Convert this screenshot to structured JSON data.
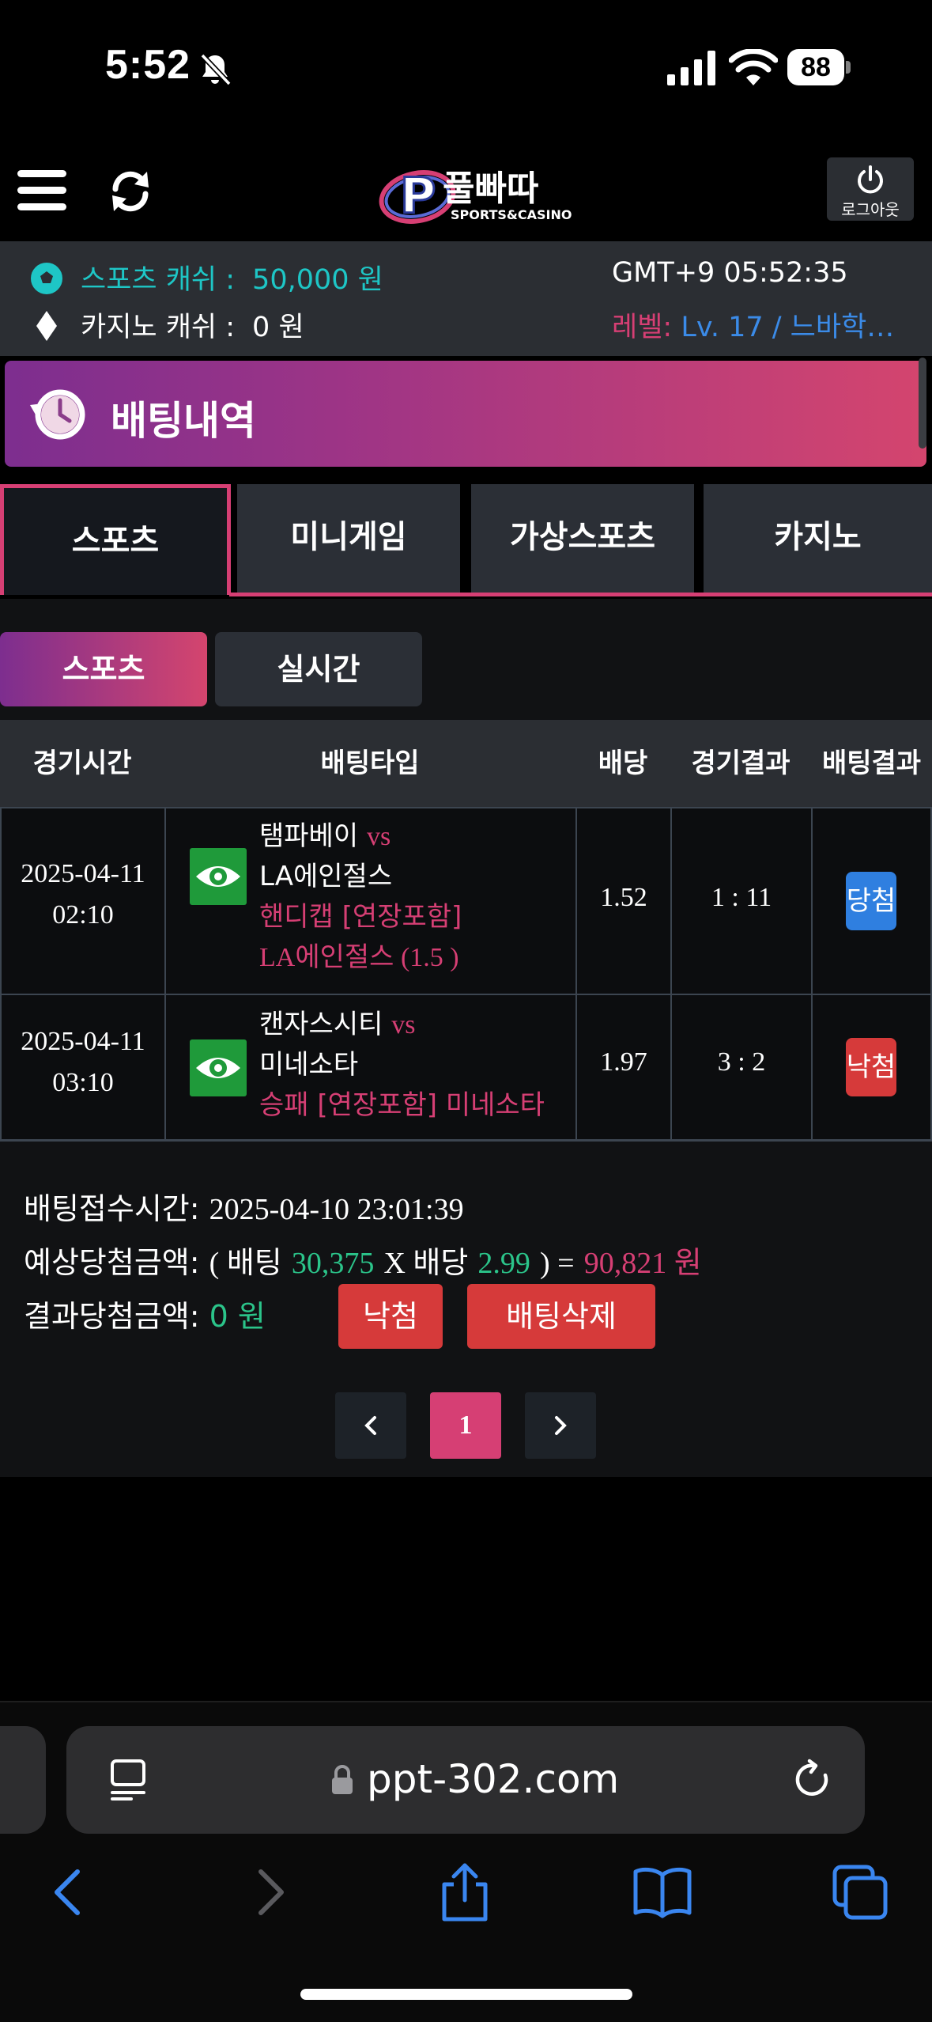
{
  "status_bar": {
    "time": "5:52",
    "battery": "88"
  },
  "header": {
    "logo_text": "풀빠따",
    "logo_sub": "SPORTS&CASINO",
    "logout_label": "로그아웃"
  },
  "info": {
    "sports_cash_label": "스포츠 캐쉬 :",
    "sports_cash_value": "50,000 원",
    "casino_cash_label": "카지노 캐쉬 :",
    "casino_cash_value": "0 원",
    "server_time": "GMT+9 05:52:35",
    "level_label": "레벨:",
    "level_value": "Lv. 17 / 느바학…"
  },
  "page_title": "배팅내역",
  "tabs": [
    "스포츠",
    "미니게임",
    "가상스포츠",
    "카지노"
  ],
  "sub_tabs": [
    "스포츠",
    "실시간"
  ],
  "table": {
    "headers": [
      "경기시간",
      "배팅타입",
      "배당",
      "경기결과",
      "배팅결과"
    ],
    "rows": [
      {
        "date": "2025-04-11",
        "time": "02:10",
        "home": "탬파베이",
        "vs": "vs",
        "away": "LA에인절스",
        "market": "핸디캡 [연장포함]",
        "pick": "LA에인절스 (1.5 )",
        "odds": "1.52",
        "score": "1 : 11",
        "result": "당첨"
      },
      {
        "date": "2025-04-11",
        "time": "03:10",
        "home": "캔자스시티",
        "vs": "vs",
        "away": "미네소타",
        "market": "승패 [연장포함] 미네소타",
        "odds": "1.97",
        "score": "3 : 2",
        "result": "낙첨"
      }
    ]
  },
  "summary": {
    "accept_label": "배팅접수시간:",
    "accept_time": "2025-04-10 23:01:39",
    "expected_label": "예상당첨금액:",
    "expected_open": "( 배팅",
    "bet_amount": "30,375",
    "times": "X 배당",
    "total_odds": "2.99",
    "equals": ") =",
    "expected_amount": "90,821 원",
    "result_label": "결과당첨금액:",
    "result_amount": "0 원",
    "status_button": "낙첨",
    "delete_button": "배팅삭제"
  },
  "pagination": {
    "current": "1"
  },
  "browser": {
    "url": "ppt-302.com"
  },
  "colors": {
    "accent_pink": "#d63f74",
    "accent_purple": "#7d2e8f",
    "teal": "#1ec6c6",
    "green": "#2bc48a",
    "win_blue": "#2f7fe0",
    "lose_red": "#d63a3a"
  }
}
